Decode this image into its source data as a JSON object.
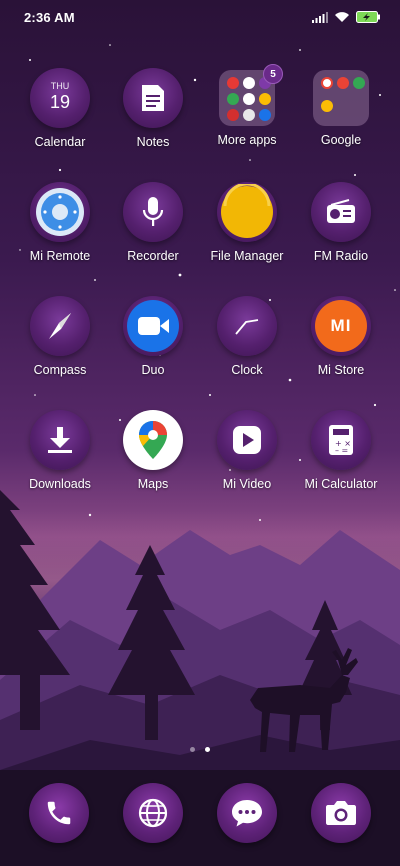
{
  "status_bar": {
    "time": "2:36 AM"
  },
  "apps": [
    {
      "name": "Calendar",
      "month": "THU",
      "day": "19"
    },
    {
      "name": "Notes"
    },
    {
      "name": "More apps",
      "badge": "5"
    },
    {
      "name": "Google"
    },
    {
      "name": "Mi Remote"
    },
    {
      "name": "Recorder"
    },
    {
      "name": "File Manager"
    },
    {
      "name": "FM Radio"
    },
    {
      "name": "Compass"
    },
    {
      "name": "Duo"
    },
    {
      "name": "Clock"
    },
    {
      "name": "Mi Store",
      "logo": "MI"
    },
    {
      "name": "Downloads"
    },
    {
      "name": "Maps"
    },
    {
      "name": "Mi Video"
    },
    {
      "name": "Mi Calculator"
    }
  ],
  "page_indicator": {
    "pages": 2,
    "current": 2
  },
  "dock": [
    "phone-icon",
    "browser-globe-icon",
    "messages-icon",
    "camera-icon"
  ],
  "colors": {
    "accent": "#5e2278",
    "file_manager": "#f2b705",
    "mi_store": "#f26a1b",
    "duo": "#1a73e8"
  }
}
